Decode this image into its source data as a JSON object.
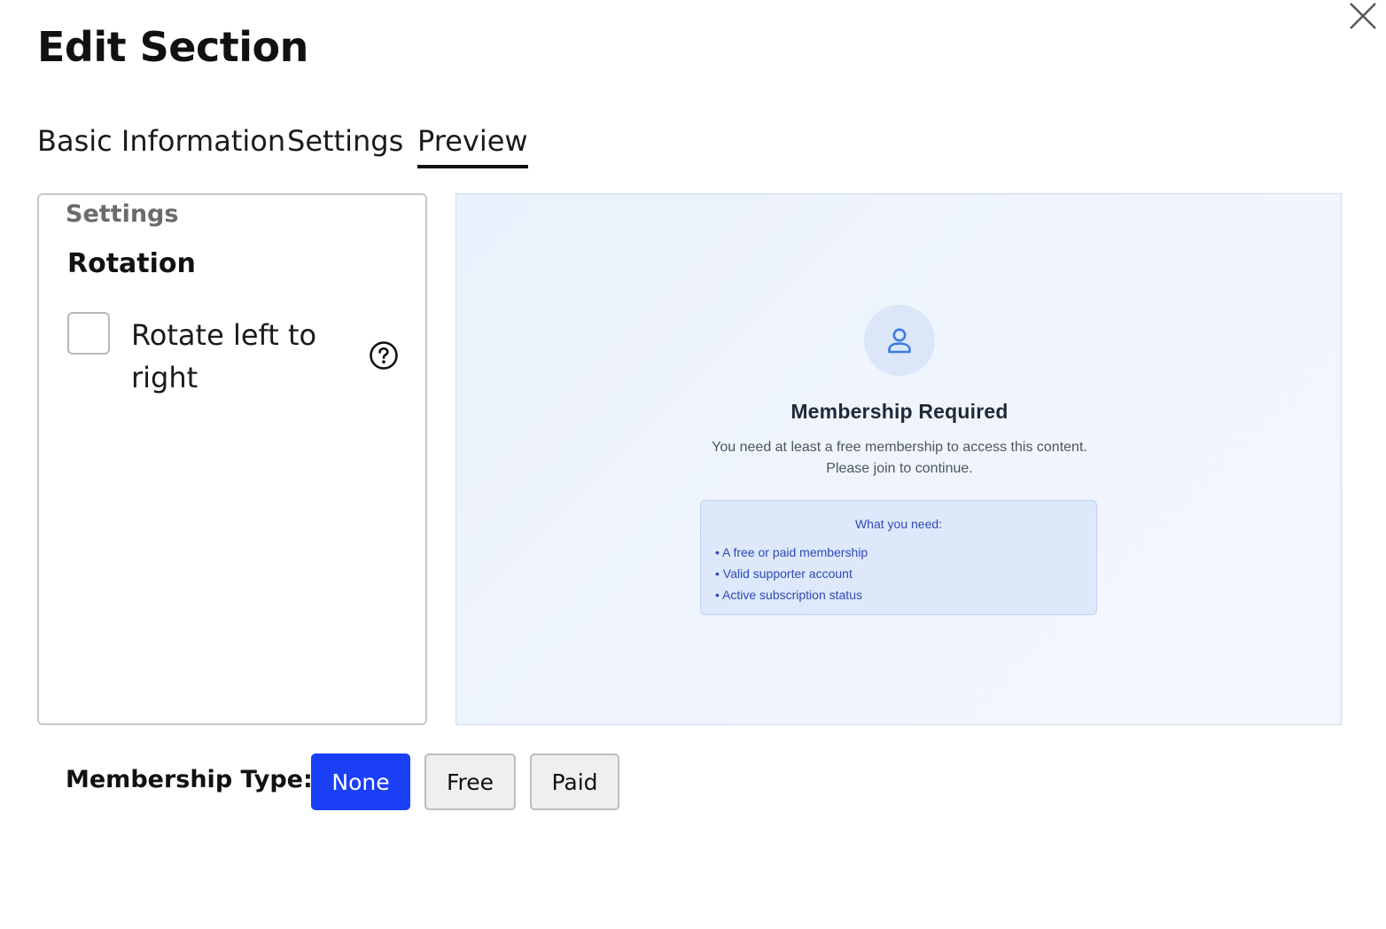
{
  "dialog": {
    "title": "Edit Section"
  },
  "tabs": [
    {
      "label": "Basic Information",
      "active": false
    },
    {
      "label": "Settings",
      "active": false
    },
    {
      "label": "Preview",
      "active": true
    }
  ],
  "settings_panel": {
    "legend": "Settings",
    "heading": "Rotation",
    "checkbox_label": "Rotate left to right",
    "checkbox_checked": false
  },
  "preview": {
    "icon": "user-icon",
    "title": "Membership Required",
    "description_line1": "You need at least a free membership to access this content.",
    "description_line2": "Please join to continue.",
    "need_title": "What you need:",
    "need_items": [
      "• A free or paid membership",
      "• Valid supporter account",
      "• Active subscription status"
    ]
  },
  "membership": {
    "label": "Membership Type:",
    "options": [
      "None",
      "Free",
      "Paid"
    ],
    "selected": "None"
  },
  "colors": {
    "primary": "#1a3ff5",
    "preview_accent": "#2f4ab6"
  }
}
